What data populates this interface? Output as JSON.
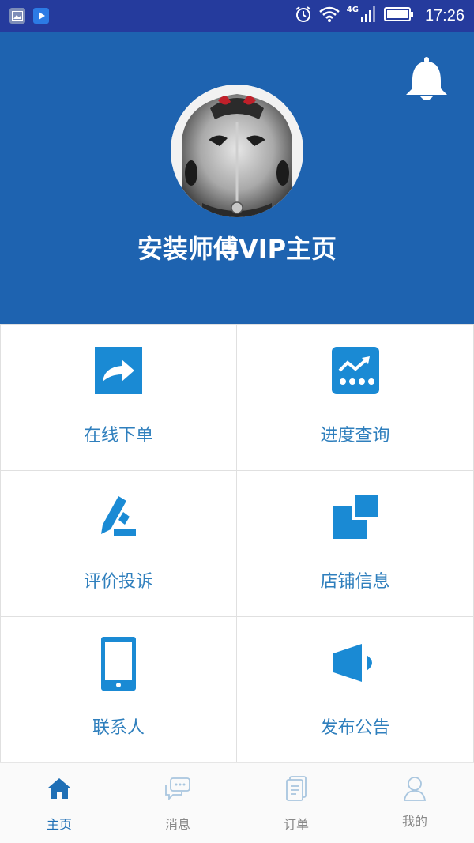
{
  "status_bar": {
    "time": "17:26",
    "network": "4G",
    "icons": [
      "gallery-notification-icon",
      "video-player-notification-icon",
      "alarm-icon",
      "wifi-icon",
      "signal-icon",
      "battery-icon"
    ]
  },
  "header": {
    "title": "安装师傅VIP主页",
    "background_color": "#1e63b0",
    "notification_icon": "bell-icon",
    "avatar": "car-avatar"
  },
  "grid": {
    "tiles": [
      {
        "label": "在线下单",
        "icon": "share-arrow-icon"
      },
      {
        "label": "进度查询",
        "icon": "trend-chart-icon"
      },
      {
        "label": "评价投诉",
        "icon": "pen-edit-icon"
      },
      {
        "label": "店铺信息",
        "icon": "store-blocks-icon"
      },
      {
        "label": "联系人",
        "icon": "phone-icon"
      },
      {
        "label": "发布公告",
        "icon": "speaker-icon"
      }
    ],
    "icon_color": "#1a8ad4",
    "label_color": "#2f7fbd"
  },
  "bottom_nav": {
    "items": [
      {
        "label": "主页",
        "icon": "home-icon",
        "active": true
      },
      {
        "label": "消息",
        "icon": "chat-bubbles-icon",
        "active": false
      },
      {
        "label": "订单",
        "icon": "orders-icon",
        "active": false
      },
      {
        "label": "我的",
        "icon": "user-icon",
        "active": false
      }
    ],
    "active_color": "#1f6fb5"
  }
}
